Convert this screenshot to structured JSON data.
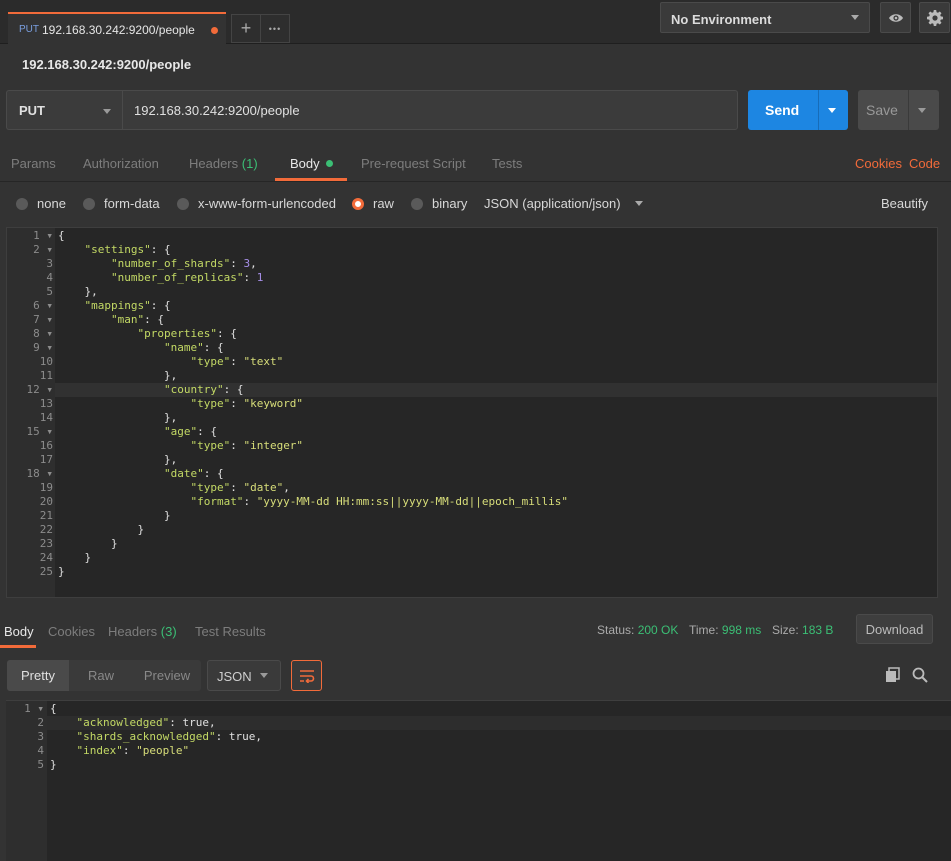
{
  "tabs": {
    "active": {
      "method": "PUT",
      "title": "192.168.30.242:9200/people"
    },
    "add_label": "+",
    "more_label": "•••"
  },
  "environment": {
    "selected": "No Environment"
  },
  "icons": {
    "eye": "eye-icon",
    "settings": "gear-icon"
  },
  "request": {
    "title": "192.168.30.242:9200/people",
    "method": "PUT",
    "url": "192.168.30.242:9200/people",
    "send_label": "Send",
    "save_label": "Save"
  },
  "request_tabs": [
    {
      "label": "Params"
    },
    {
      "label": "Authorization"
    },
    {
      "label": "Headers",
      "count": "(1)"
    },
    {
      "label": "Body"
    },
    {
      "label": "Pre-request Script"
    },
    {
      "label": "Tests"
    }
  ],
  "links": {
    "cookies": "Cookies",
    "code": "Code",
    "beautify": "Beautify"
  },
  "body_types": [
    {
      "label": "none",
      "selected": false
    },
    {
      "label": "form-data",
      "selected": false
    },
    {
      "label": "x-www-form-urlencoded",
      "selected": false
    },
    {
      "label": "raw",
      "selected": true
    },
    {
      "label": "binary",
      "selected": false
    }
  ],
  "content_type": "JSON (application/json)",
  "request_body": {
    "lines": [
      "{",
      "    \"settings\": {",
      "        \"number_of_shards\": 3,",
      "        \"number_of_replicas\": 1",
      "    },",
      "    \"mappings\": {",
      "        \"man\": {",
      "            \"properties\": {",
      "                \"name\": {",
      "                    \"type\": \"text\"",
      "                },",
      "                \"country\": {",
      "                    \"type\": \"keyword\"",
      "                },",
      "                \"age\": {",
      "                    \"type\": \"integer\"",
      "                },",
      "                \"date\": {",
      "                    \"type\": \"date\",",
      "                    \"format\": \"yyyy-MM-dd HH:mm:ss||yyyy-MM-dd||epoch_millis\"",
      "                }",
      "            }",
      "        }",
      "    }",
      "}"
    ]
  },
  "response_tabs": [
    {
      "label": "Body"
    },
    {
      "label": "Cookies"
    },
    {
      "label": "Headers",
      "count": "(3)"
    },
    {
      "label": "Test Results"
    }
  ],
  "response_meta": {
    "status_label": "Status:",
    "status": "200 OK",
    "time_label": "Time:",
    "time": "998 ms",
    "size_label": "Size:",
    "size": "183 B",
    "download_label": "Download"
  },
  "response_view": {
    "pretty": "Pretty",
    "raw": "Raw",
    "preview": "Preview",
    "format": "JSON"
  },
  "response_body": {
    "lines": [
      "{",
      "    \"acknowledged\": true,",
      "    \"shards_acknowledged\": true,",
      "    \"index\": \"people\"",
      "}"
    ]
  },
  "colors": {
    "accent": "#f26b3a",
    "send": "#1d86e2",
    "success": "#3bbf75"
  }
}
